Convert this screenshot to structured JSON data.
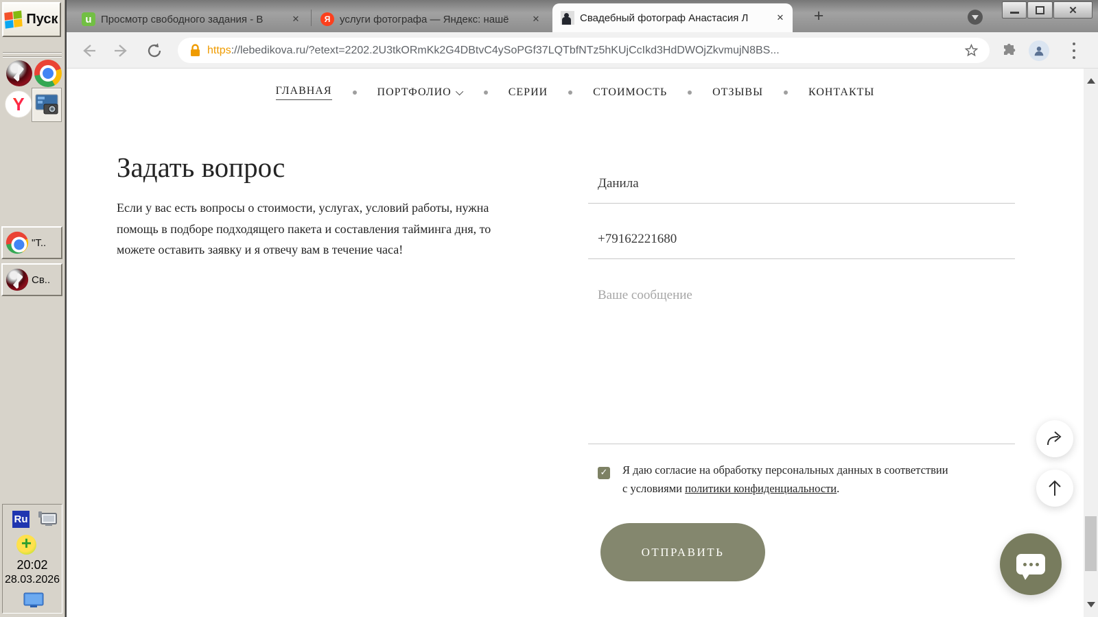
{
  "taskbar": {
    "start_label": "Пуск",
    "window_buttons": [
      {
        "label": "\"Т.."
      },
      {
        "label": "Св.."
      }
    ],
    "tray": {
      "lang": "Ru",
      "time": "20:02",
      "date": "28.03.2026"
    }
  },
  "browser": {
    "tabs": [
      {
        "title": "Просмотр свободного задания - В"
      },
      {
        "title": "услуги фотографа — Яндекс: нашё"
      },
      {
        "title": "Свадебный фотограф Анастасия Л"
      }
    ],
    "favicons": {
      "tab1_letter": "u",
      "tab2_letter": "Я"
    },
    "new_tab_label": "+",
    "close_glyph": "✕",
    "url_scheme": "https",
    "url_rest": "://lebedikova.ru/?etext=2202.2U3tkORmKk2G4DBtvC4ySoPGf37LQTbfNTz5hKUjCcIkd3HdDWOjZkvmujN8BS..."
  },
  "site": {
    "nav": [
      "ГЛАВНАЯ",
      "ПОРТФОЛИО",
      "СЕРИИ",
      "СТОИМОСТЬ",
      "ОТЗЫВЫ",
      "КОНТАКТЫ"
    ],
    "heading": "Задать вопрос",
    "description": "Если у вас есть вопросы о стоимости, услугах, условий работы, нужна помощь в подборе подходящего пакета и составления тайминга дня, то можете оставить заявку и я отвечу вам в течение часа!",
    "form": {
      "name_value": "Данила",
      "phone_value": "+79162221680",
      "message_placeholder": "Ваше сообщение",
      "consent_line1": "Я даю согласие на обработку персональных данных в соответствии",
      "consent_line2_prefix": "с условиями ",
      "consent_link": "политики конфиденциальности",
      "consent_line2_suffix": ".",
      "checkbox_glyph": "✓",
      "submit_label": "ОТПРАВИТЬ"
    },
    "colors": {
      "accent_olive": "#84876e",
      "checkbox_olive": "#7d8164",
      "chat_olive": "#787c5e"
    }
  }
}
